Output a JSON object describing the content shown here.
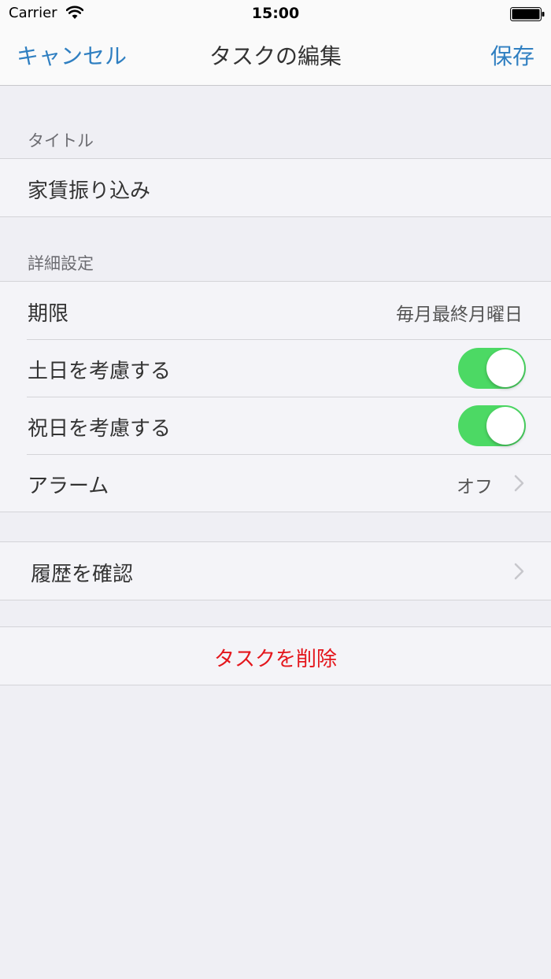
{
  "status_bar": {
    "carrier": "Carrier",
    "time": "15:00"
  },
  "nav": {
    "cancel_label": "キャンセル",
    "title": "タスクの編集",
    "save_label": "保存"
  },
  "sections": {
    "title_header": "タイトル",
    "task_title": "家賃振り込み",
    "details_header": "詳細設定",
    "deadline": {
      "label": "期限",
      "value": "毎月最終月曜日"
    },
    "weekend": {
      "label": "土日を考慮する",
      "on": true
    },
    "holiday": {
      "label": "祝日を考慮する",
      "on": true
    },
    "alarm": {
      "label": "アラーム",
      "value": "オフ"
    },
    "history_label": "履歴を確認",
    "delete_label": "タスクを削除"
  },
  "colors": {
    "accent": "#2f7fc1",
    "toggle_on": "#4cd964",
    "destructive": "#e4161c",
    "background": "#efeff4"
  },
  "icons": [
    "wifi-icon",
    "battery-icon",
    "chevron-right-icon"
  ]
}
